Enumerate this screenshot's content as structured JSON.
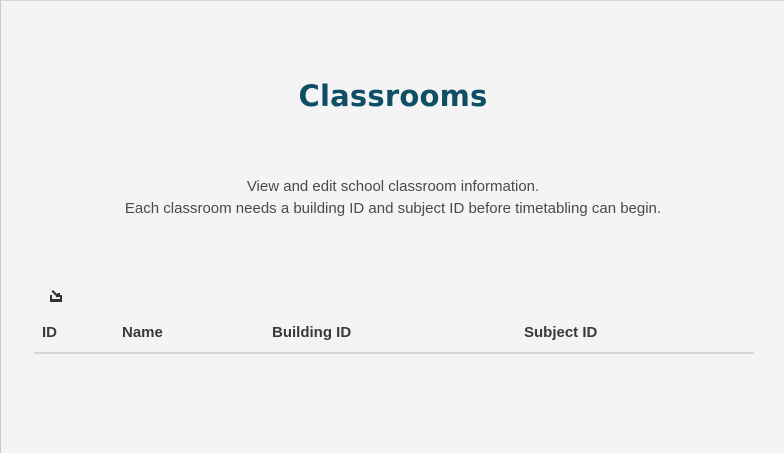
{
  "header": {
    "title": "Classrooms"
  },
  "description": {
    "line1": "View and edit school classroom information.",
    "line2": "Each classroom needs a building ID and subject ID before timetabling can begin."
  },
  "toolbar": {
    "export_icon": "export-icon"
  },
  "table": {
    "columns": [
      "ID",
      "Name",
      "Building ID",
      "Subject ID"
    ],
    "rows": []
  },
  "colors": {
    "title": "#0e4f66",
    "background": "#f4f4f4",
    "text": "#444444",
    "divider": "#d6d6d6"
  }
}
